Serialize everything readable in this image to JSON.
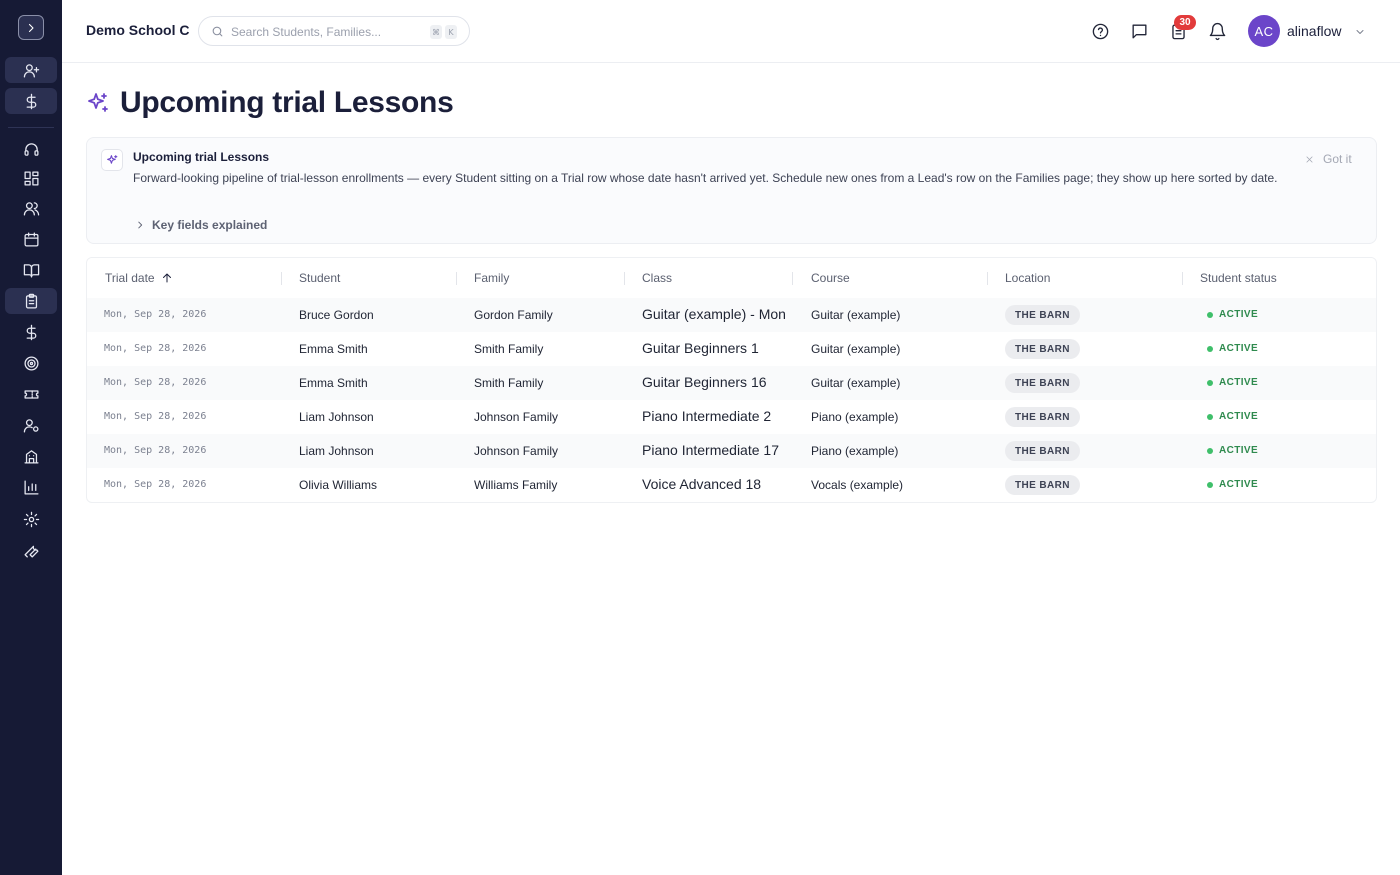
{
  "topbar": {
    "school_name": "Demo School C",
    "search_placeholder": "Search Students, Families...",
    "shortcut_mod": "⌘",
    "shortcut_key": "K",
    "tasks_badge": "30",
    "user_initials": "AC",
    "username": "alinaflow"
  },
  "page": {
    "title": "Upcoming trial Lessons"
  },
  "info": {
    "title": "Upcoming trial Lessons",
    "text": "Forward-looking pipeline of trial-lesson enrollments — every Student sitting on a Trial row whose date hasn't arrived yet. Schedule new ones from a Lead's row on the Families page; they show up here sorted by date.",
    "key_fields_label": "Key fields explained",
    "dismiss_label": "Got it"
  },
  "table": {
    "columns": [
      "Trial date",
      "Student",
      "Family",
      "Class",
      "Course",
      "Location",
      "Student status"
    ],
    "rows": [
      {
        "date": "Mon, Sep 28, 2026",
        "student": "Bruce Gordon",
        "family": "Gordon Family",
        "class": "Guitar (example) - Mon",
        "course": "Guitar (example)",
        "location": "THE BARN",
        "status": "ACTIVE"
      },
      {
        "date": "Mon, Sep 28, 2026",
        "student": "Emma Smith",
        "family": "Smith Family",
        "class": "Guitar Beginners 1",
        "course": "Guitar (example)",
        "location": "THE BARN",
        "status": "ACTIVE"
      },
      {
        "date": "Mon, Sep 28, 2026",
        "student": "Emma Smith",
        "family": "Smith Family",
        "class": "Guitar Beginners 16",
        "course": "Guitar (example)",
        "location": "THE BARN",
        "status": "ACTIVE"
      },
      {
        "date": "Mon, Sep 28, 2026",
        "student": "Liam Johnson",
        "family": "Johnson Family",
        "class": "Piano Intermediate 2",
        "course": "Piano (example)",
        "location": "THE BARN",
        "status": "ACTIVE"
      },
      {
        "date": "Mon, Sep 28, 2026",
        "student": "Liam Johnson",
        "family": "Johnson Family",
        "class": "Piano Intermediate 17",
        "course": "Piano (example)",
        "location": "THE BARN",
        "status": "ACTIVE"
      },
      {
        "date": "Mon, Sep 28, 2026",
        "student": "Olivia Williams",
        "family": "Williams Family",
        "class": "Voice Advanced 18",
        "course": "Vocals (example)",
        "location": "THE BARN",
        "status": "ACTIVE"
      }
    ]
  },
  "colors": {
    "sidebar_bg": "#161a35",
    "accent": "#6b45c9",
    "badge": "#e23b3b",
    "status_active": "#2f8a4e"
  }
}
